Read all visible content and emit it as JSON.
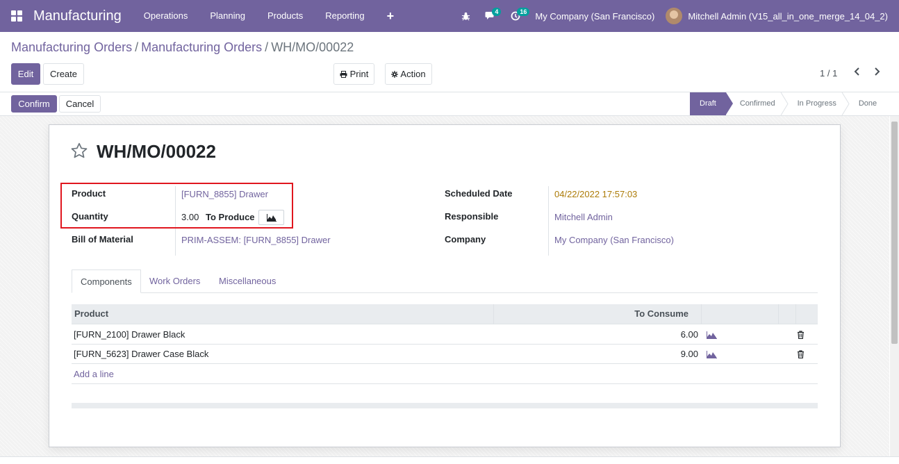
{
  "navbar": {
    "app_name": "Manufacturing",
    "menu": [
      "Operations",
      "Planning",
      "Products",
      "Reporting"
    ],
    "messages_badge": "4",
    "activities_badge": "16",
    "company": "My Company (San Francisco)",
    "user": "Mitchell Admin (V15_all_in_one_merge_14_04_2)"
  },
  "breadcrumb": {
    "items": [
      "Manufacturing Orders",
      "Manufacturing Orders"
    ],
    "current": "WH/MO/00022"
  },
  "toolbar": {
    "edit": "Edit",
    "create": "Create",
    "print": "Print",
    "action": "Action",
    "pager": "1 / 1"
  },
  "statusbar": {
    "confirm": "Confirm",
    "cancel": "Cancel",
    "stages": [
      "Draft",
      "Confirmed",
      "In Progress",
      "Done"
    ],
    "current_stage": "Draft"
  },
  "record": {
    "title": "WH/MO/00022",
    "left_fields": {
      "product_label": "Product",
      "product_value": "[FURN_8855] Drawer",
      "quantity_label": "Quantity",
      "quantity_value": "3.00",
      "quantity_unit": "To Produce",
      "bom_label": "Bill of Material",
      "bom_value": "PRIM-ASSEM: [FURN_8855] Drawer"
    },
    "right_fields": {
      "date_label": "Scheduled Date",
      "date_value": "04/22/2022 17:57:03",
      "responsible_label": "Responsible",
      "responsible_value": "Mitchell Admin",
      "company_label": "Company",
      "company_value": "My Company (San Francisco)"
    }
  },
  "tabs": [
    "Components",
    "Work Orders",
    "Miscellaneous"
  ],
  "components_table": {
    "headers": [
      "Product",
      "To Consume"
    ],
    "rows": [
      {
        "product": "[FURN_2100] Drawer Black",
        "to_consume": "6.00"
      },
      {
        "product": "[FURN_5623] Drawer Case Black",
        "to_consume": "9.00"
      }
    ],
    "add_line": "Add a line"
  },
  "colors": {
    "brand": "#71639e",
    "highlight": "#e0161e",
    "warning": "#ac7b07"
  }
}
